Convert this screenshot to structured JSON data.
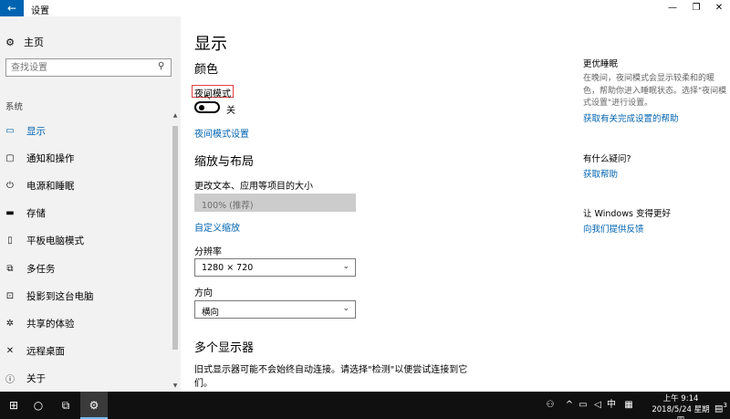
{
  "window": {
    "title": "设置",
    "back_icon": "←",
    "minimize_icon": "—",
    "restore_icon": "❐",
    "close_icon": "✕"
  },
  "sidebar": {
    "home_label": "主页",
    "search_placeholder": "查找设置",
    "section_label": "系统",
    "items": [
      {
        "icon": "▭",
        "label": "显示"
      },
      {
        "icon": "▢",
        "label": "通知和操作"
      },
      {
        "icon": "⏻",
        "label": "电源和睡眠"
      },
      {
        "icon": "▬",
        "label": "存储"
      },
      {
        "icon": "▯",
        "label": "平板电脑模式"
      },
      {
        "icon": "⧉",
        "label": "多任务"
      },
      {
        "icon": "⊡",
        "label": "投影到这台电脑"
      },
      {
        "icon": "✲",
        "label": "共享的体验"
      },
      {
        "icon": "✕",
        "label": "远程桌面"
      },
      {
        "icon": "ⓘ",
        "label": "关于"
      }
    ]
  },
  "main": {
    "title": "显示",
    "color_heading": "颜色",
    "night_mode_label": "夜间模式",
    "night_mode_state": "关",
    "night_mode_settings_link": "夜间模式设置",
    "scale_heading": "缩放与布局",
    "scale_label": "更改文本、应用等项目的大小",
    "scale_value": "100% (推荐)",
    "custom_scale_link": "自定义缩放",
    "resolution_label": "分辨率",
    "resolution_value": "1280 × 720",
    "orientation_label": "方向",
    "orientation_value": "横向",
    "multi_display_heading": "多个显示器",
    "multi_display_desc": "旧式显示器可能不会始终自动连接。请选择\"检测\"以便尝试连接到它们。"
  },
  "right": {
    "sleep_title": "更优睡眠",
    "sleep_text": "在晚间，夜间模式会显示较柔和的暖色，帮助你进入睡眠状态。选择\"夜间模式设置\"进行设置。",
    "sleep_link": "获取有关完成设置的帮助",
    "question_title": "有什么疑问?",
    "help_link": "获取帮助",
    "better_title": "让 Windows 变得更好",
    "feedback_link": "向我们提供反馈"
  },
  "taskbar": {
    "time": "上午 9:14",
    "date": "2018/5/24 星期四",
    "ime": "中",
    "notification_count": "3"
  }
}
